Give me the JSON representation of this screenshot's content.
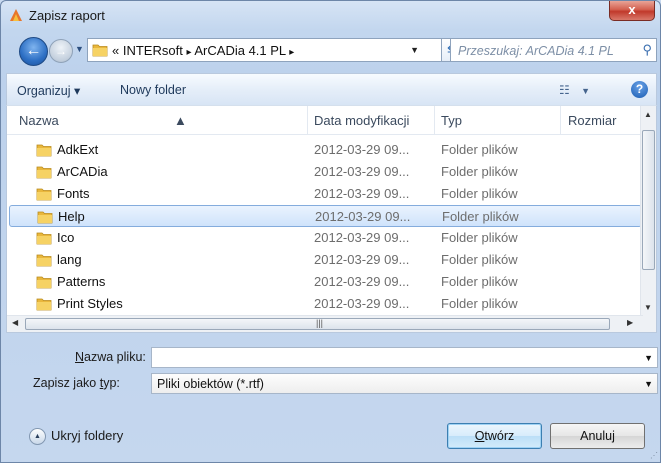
{
  "window": {
    "title": "Zapisz raport",
    "close_glyph": "x"
  },
  "nav": {
    "back_glyph": "←",
    "forward_glyph": "→",
    "breadcrumb": [
      "«",
      "INTERsoft",
      "ArCADia 4.1 PL"
    ],
    "breadcrumb_sep": "▸",
    "search_placeholder": "Przeszukaj: ArCADia 4.1 PL"
  },
  "toolbar": {
    "organize_label": "Organizuj ▾",
    "new_folder_label": "Nowy folder"
  },
  "columns": {
    "name": "Nazwa",
    "date": "Data modyfikacji",
    "type": "Typ",
    "size": "Rozmiar"
  },
  "rows": [
    {
      "name": "AdkExt",
      "date": "2012-03-29 09...",
      "type": "Folder plików",
      "selected": false
    },
    {
      "name": "ArCADia",
      "date": "2012-03-29 09...",
      "type": "Folder plików",
      "selected": false
    },
    {
      "name": "Fonts",
      "date": "2012-03-29 09...",
      "type": "Folder plików",
      "selected": false
    },
    {
      "name": "Help",
      "date": "2012-03-29 09...",
      "type": "Folder plików",
      "selected": true
    },
    {
      "name": "Ico",
      "date": "2012-03-29 09...",
      "type": "Folder plików",
      "selected": false
    },
    {
      "name": "lang",
      "date": "2012-03-29 09...",
      "type": "Folder plików",
      "selected": false
    },
    {
      "name": "Patterns",
      "date": "2012-03-29 09...",
      "type": "Folder plików",
      "selected": false
    },
    {
      "name": "Print Styles",
      "date": "2012-03-29 09...",
      "type": "Folder plików",
      "selected": false
    }
  ],
  "form": {
    "filename_label_u": "N",
    "filename_label_rest": "azwa pliku:",
    "filename_value": "",
    "savetype_label_pre": "Zapisz jako ",
    "savetype_label_u": "t",
    "savetype_label_rest": "yp:",
    "savetype_value": "Pliki obiektów (*.rtf)"
  },
  "footer": {
    "hide_folders_label": "Ukryj foldery",
    "open_button_u": "O",
    "open_button_rest": "twórz",
    "cancel_button": "Anuluj"
  },
  "colors": {
    "accent": "#2d6fc4",
    "selection": "#cfe3fb",
    "folder": "#f2c245"
  }
}
